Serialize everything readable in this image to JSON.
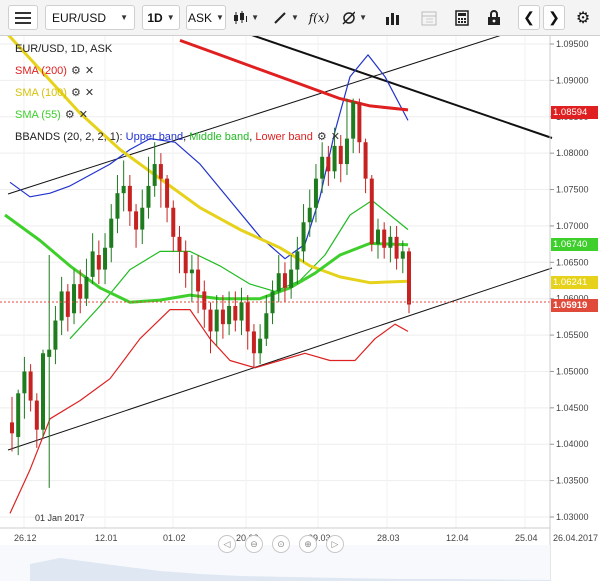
{
  "toolbar": {
    "menu_icon": "hamburger-icon",
    "symbol": "EUR/USD",
    "timeframe": "1D",
    "price_type": "ASK",
    "icons": [
      "candles-icon",
      "draw-line-icon",
      "function-icon",
      "crosshair-icon",
      "bar-chart-icon",
      "calendar-icon",
      "calculator-icon",
      "lock-icon",
      "chevron-left-icon",
      "chevron-right-icon",
      "gear-icon"
    ]
  },
  "header": {
    "instrument_line": "EUR/USD, 1D, ASK"
  },
  "indicators": [
    {
      "label": "SMA (200)",
      "color": "#e02020"
    },
    {
      "label": "SMA (100)",
      "color": "#e6d21a"
    },
    {
      "label": "SMA (55)",
      "color": "#3fcf2c"
    }
  ],
  "bbands": {
    "label": "BBANDS (20, 2, 2, 1):",
    "upper": "Upper band",
    "middle": "Middle band",
    "lower": "Lower band",
    "upper_color": "#2233cc",
    "middle_color": "#22bb22",
    "lower_color": "#dd2222"
  },
  "price_tags": [
    {
      "value": "1.08594",
      "color": "#e02020"
    },
    {
      "value": "1.06740",
      "color": "#3fcf2c"
    },
    {
      "value": "1.06241",
      "color": "#e6d21a"
    },
    {
      "value": "1.05919",
      "color": "#e04a3a"
    }
  ],
  "chart_data": {
    "type": "candlestick",
    "title": "EUR/USD, 1D, ASK",
    "y_ticks": [
      "1.09500",
      "1.09000",
      "1.08500",
      "1.08000",
      "1.07500",
      "1.07000",
      "1.06500",
      "1.06000",
      "1.05500",
      "1.05000",
      "1.04500",
      "1.04000",
      "1.03500",
      "1.03000"
    ],
    "x_ticks": [
      "26.12",
      "12.01",
      "01.02",
      "20.02",
      "09.03",
      "28.03",
      "12.04",
      "25.04",
      "26.04.2017"
    ],
    "annotation": "01 Jan 2017",
    "ylim": [
      1.029,
      1.097
    ],
    "last_price": 1.05919,
    "sma200_last": 1.08594,
    "sma55_last": 1.0674,
    "sma100_last": 1.06241,
    "candles": [
      [
        1.043,
        1.0415,
        1.0465,
        1.039
      ],
      [
        1.041,
        1.047,
        1.0475,
        1.0385
      ],
      [
        1.047,
        1.05,
        1.052,
        1.0435
      ],
      [
        1.05,
        1.046,
        1.051,
        1.0445
      ],
      [
        1.046,
        1.042,
        1.047,
        1.0395
      ],
      [
        1.042,
        1.0525,
        1.053,
        1.041
      ],
      [
        1.052,
        1.053,
        1.066,
        1.034
      ],
      [
        1.053,
        1.057,
        1.059,
        1.051
      ],
      [
        1.057,
        1.061,
        1.063,
        1.055
      ],
      [
        1.061,
        1.0575,
        1.062,
        1.0555
      ],
      [
        1.058,
        1.062,
        1.064,
        1.0565
      ],
      [
        1.062,
        1.06,
        1.064,
        1.058
      ],
      [
        1.06,
        1.063,
        1.0655,
        1.059
      ],
      [
        1.063,
        1.0665,
        1.069,
        1.062
      ],
      [
        1.066,
        1.064,
        1.068,
        1.062
      ],
      [
        1.064,
        1.067,
        1.069,
        1.062
      ],
      [
        1.067,
        1.071,
        1.073,
        1.065
      ],
      [
        1.071,
        1.0745,
        1.077,
        1.069
      ],
      [
        1.0745,
        1.0755,
        1.079,
        1.072
      ],
      [
        1.0755,
        1.072,
        1.077,
        1.07
      ],
      [
        1.072,
        1.0695,
        1.073,
        1.067
      ],
      [
        1.0695,
        1.0725,
        1.075,
        1.0675
      ],
      [
        1.0725,
        1.0755,
        1.0795,
        1.071
      ],
      [
        1.0755,
        1.0785,
        1.0815,
        1.074
      ],
      [
        1.0785,
        1.0765,
        1.08,
        1.0725
      ],
      [
        1.0765,
        1.0725,
        1.077,
        1.0705
      ],
      [
        1.0725,
        1.0685,
        1.0735,
        1.0665
      ],
      [
        1.0685,
        1.0665,
        1.07,
        1.0635
      ],
      [
        1.0665,
        1.0635,
        1.068,
        1.0615
      ],
      [
        1.0635,
        1.064,
        1.066,
        1.0595
      ],
      [
        1.064,
        1.061,
        1.066,
        1.058
      ],
      [
        1.061,
        1.0585,
        1.0625,
        1.056
      ],
      [
        1.0585,
        1.0555,
        1.0595,
        1.0525
      ],
      [
        1.0555,
        1.0585,
        1.0605,
        1.0535
      ],
      [
        1.0585,
        1.0565,
        1.0605,
        1.0545
      ],
      [
        1.0565,
        1.059,
        1.061,
        1.055
      ],
      [
        1.059,
        1.057,
        1.061,
        1.0555
      ],
      [
        1.057,
        1.0595,
        1.0615,
        1.055
      ],
      [
        1.0595,
        1.0555,
        1.0605,
        1.053
      ],
      [
        1.0555,
        1.0525,
        1.0565,
        1.0505
      ],
      [
        1.0525,
        1.0545,
        1.0565,
        1.051
      ],
      [
        1.0545,
        1.058,
        1.0605,
        1.0535
      ],
      [
        1.058,
        1.061,
        1.0625,
        1.0565
      ],
      [
        1.061,
        1.0635,
        1.066,
        1.0595
      ],
      [
        1.0635,
        1.0615,
        1.065,
        1.0595
      ],
      [
        1.0615,
        1.064,
        1.066,
        1.06
      ],
      [
        1.064,
        1.0665,
        1.0685,
        1.062
      ],
      [
        1.0665,
        1.0705,
        1.073,
        1.065
      ],
      [
        1.0705,
        1.0725,
        1.075,
        1.0685
      ],
      [
        1.0725,
        1.0765,
        1.0785,
        1.0705
      ],
      [
        1.0765,
        1.0795,
        1.0815,
        1.0745
      ],
      [
        1.0795,
        1.0775,
        1.081,
        1.0755
      ],
      [
        1.0775,
        1.081,
        1.0835,
        1.0765
      ],
      [
        1.081,
        1.0785,
        1.0825,
        1.076
      ],
      [
        1.0785,
        1.082,
        1.0875,
        1.077
      ],
      [
        1.082,
        1.087,
        1.0875,
        1.08
      ],
      [
        1.087,
        1.0815,
        1.0875,
        1.08
      ],
      [
        1.0815,
        1.0765,
        1.082,
        1.0745
      ],
      [
        1.0765,
        1.0675,
        1.077,
        1.0665
      ],
      [
        1.0675,
        1.0695,
        1.071,
        1.0655
      ],
      [
        1.0695,
        1.067,
        1.0705,
        1.0655
      ],
      [
        1.067,
        1.0685,
        1.07,
        1.065
      ],
      [
        1.0685,
        1.0655,
        1.07,
        1.064
      ],
      [
        1.0655,
        1.0665,
        1.068,
        1.0635
      ],
      [
        1.0665,
        1.0592,
        1.067,
        1.058
      ]
    ]
  },
  "navigator": {
    "buttons": [
      "scroll-left-icon",
      "zoom-out-icon",
      "zoom-reset-icon",
      "zoom-in-icon",
      "scroll-right-icon"
    ]
  }
}
